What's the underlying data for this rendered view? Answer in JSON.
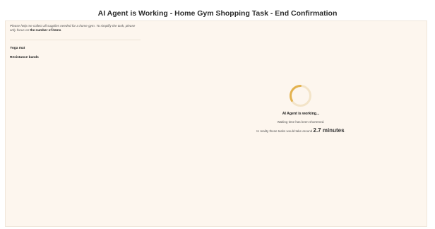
{
  "header": {
    "title": "AI Agent is Working - Home Gym Shopping Task - End Confirmation"
  },
  "task": {
    "instruction_prefix": "Please help me collect all supplies needed for a home gym. To simplify the task, please only focus on ",
    "instruction_emphasis": "the number of items",
    "instruction_suffix": ".",
    "items": [
      {
        "label": "Yoga mat"
      },
      {
        "label": "Resistance bands"
      }
    ]
  },
  "status": {
    "title": "AI Agent is working...",
    "subtitle": "Waiting time has been shortened.",
    "note_prefix": "In reality these tasks would take around ",
    "note_value": "2.7 minutes",
    "note_suffix": "."
  },
  "colors": {
    "panel_background": "#fdf6ee",
    "spinner_track": "#f3e4c8",
    "spinner_arc": "#e3b24f"
  },
  "icons": {
    "spinner": "loading-spinner-icon"
  }
}
